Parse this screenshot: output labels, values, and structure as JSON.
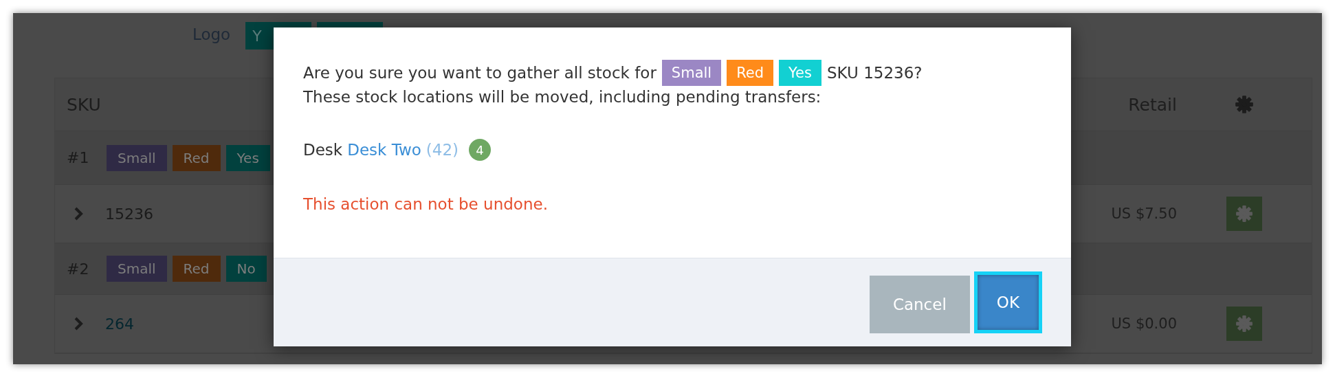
{
  "logo_field": {
    "label": "Logo",
    "options": [
      {
        "label": "Y",
        "color": "#02413e"
      },
      {
        "color": "#02413e"
      }
    ]
  },
  "table": {
    "columns": [
      {
        "label": "SKU"
      },
      {
        "label": "Retail"
      }
    ],
    "groups": [
      {
        "label": "#1",
        "tags": [
          {
            "label": "Small",
            "color": "#2f2a45"
          },
          {
            "label": "Red",
            "color": "#4f2a0c"
          },
          {
            "label": "Yes",
            "color": "#02413e"
          }
        ],
        "item": {
          "sku": "15236",
          "link": false,
          "retail": "US $7.50"
        }
      },
      {
        "label": "#2",
        "tags": [
          {
            "label": "Small",
            "color": "#2f2a45"
          },
          {
            "label": "Red",
            "color": "#4f2a0c"
          },
          {
            "label": "No",
            "color": "#02413e"
          }
        ],
        "item": {
          "sku": "264",
          "link": true,
          "retail": "US $0.00"
        }
      }
    ]
  },
  "dialog": {
    "question_prefix": "Are you sure you want to gather all stock for",
    "question_tags": [
      {
        "label": "Small",
        "color": "#9b87c4"
      },
      {
        "label": "Red",
        "color": "#ff8b1a"
      },
      {
        "label": "Yes",
        "color": "#12d0d2"
      }
    ],
    "question_suffix": "SKU 15236?",
    "note": "These stock locations will be moved, including pending transfers:",
    "locations": [
      {
        "type_label": "Desk",
        "name": "Desk Two",
        "count": "(42)",
        "badge": "4"
      }
    ],
    "warning": "This action can not be undone.",
    "buttons": [
      {
        "label": "Cancel",
        "kind": "secondary",
        "focused": false
      },
      {
        "label": "OK",
        "kind": "primary",
        "focused": true
      }
    ]
  }
}
